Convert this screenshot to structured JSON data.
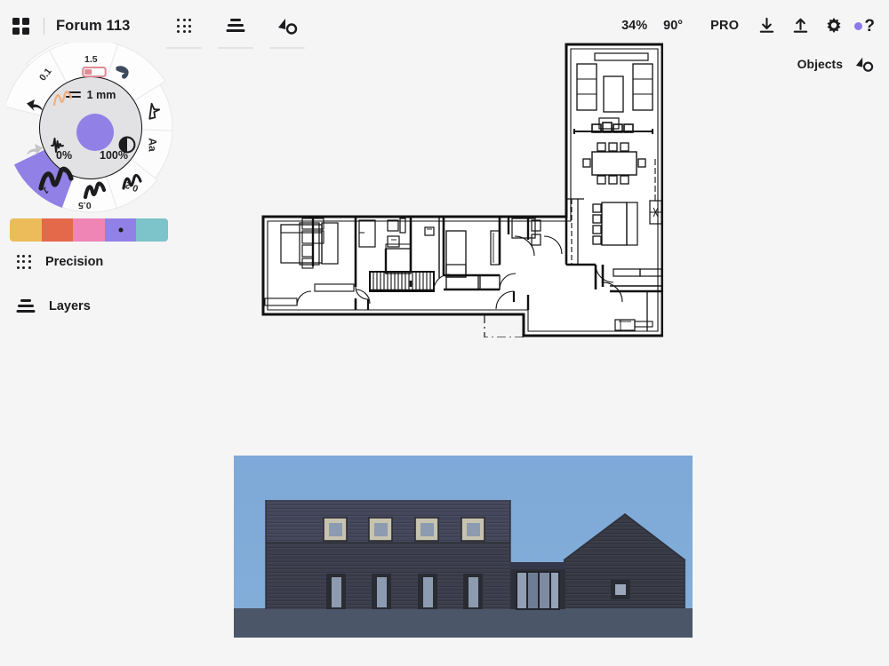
{
  "app": {
    "background": "#f5f5f6",
    "accent": "#9180e6"
  },
  "topbar": {
    "apps_icon": "grid-squares-icon",
    "document_title": "Forum 113",
    "tools": [
      {
        "name": "precision-grid-tool",
        "icon": "nine-dots-icon"
      },
      {
        "name": "layers-tool",
        "icon": "layer-stack-icon"
      },
      {
        "name": "objects-tool",
        "icon": "object-node-icon"
      }
    ],
    "zoom_level": "34%",
    "rotation": "90°",
    "pro_label": "PRO",
    "download_icon": "download-icon",
    "upload_icon": "upload-icon",
    "settings_icon": "gear-icon",
    "help_icon": "help-question-icon"
  },
  "objects_bar": {
    "label": "Objects",
    "icon": "object-node-icon"
  },
  "wheel": {
    "hub": {
      "line_icon": "line-weight-icon",
      "size_value": "1 mm",
      "opacity_min": "0%",
      "opacity_max": "100%",
      "pressure_icon": "pressure-curve-icon",
      "contrast_icon": "contrast-half-circle-icon",
      "color_swatch": "#9180e6"
    },
    "segments": [
      {
        "name": "wheel-segment-0-1",
        "label": "0.1",
        "glyph": "stroke-thin-icon",
        "selected": false,
        "color": "#f0b183"
      },
      {
        "name": "wheel-segment-1-5",
        "label": "1.5",
        "glyph": "eraser-icon",
        "selected": false,
        "color": "#de8b95"
      },
      {
        "name": "wheel-segment-marker",
        "label": "",
        "glyph": "marker-blob-icon",
        "selected": false,
        "color": "#3d4a5c"
      },
      {
        "name": "wheel-segment-select",
        "label": "",
        "glyph": "cursor-arrow-icon",
        "selected": false,
        "color": "#1c1c1e"
      },
      {
        "name": "wheel-segment-text",
        "label": "Aa",
        "glyph": "text-icon",
        "selected": false,
        "color": "#1c1c1e"
      },
      {
        "name": "wheel-segment-0-2",
        "label": "0.2",
        "glyph": "stroke-medium-icon",
        "selected": false,
        "color": "#1c1c1e"
      },
      {
        "name": "wheel-segment-0-5",
        "label": "0.5",
        "glyph": "stroke-thick-icon",
        "selected": false,
        "color": "#1c1c1e"
      },
      {
        "name": "wheel-segment-1",
        "label": "1",
        "glyph": "stroke-current-icon",
        "selected": true,
        "color": "#9180e6"
      }
    ],
    "undo_icon": "undo-arrow-icon",
    "redo_icon": "redo-arrow-icon",
    "redo_disabled": true
  },
  "palette": {
    "swatches": [
      {
        "name": "color-swatch-yellow",
        "color": "#edbc5a",
        "selected": false
      },
      {
        "name": "color-swatch-orange",
        "color": "#e4684a",
        "selected": false
      },
      {
        "name": "color-swatch-pink",
        "color": "#ee85b5",
        "selected": false
      },
      {
        "name": "color-swatch-purple",
        "color": "#9180e6",
        "selected": true
      },
      {
        "name": "color-swatch-teal",
        "color": "#7cc4c9",
        "selected": false
      }
    ]
  },
  "sidebar": {
    "precision": {
      "label": "Precision",
      "icon": "nine-dots-icon"
    },
    "layers": {
      "label": "Layers",
      "icon": "layer-stack-icon"
    }
  },
  "canvas": {
    "floorplan": {
      "name": "architectural-floor-plan",
      "description": "L-shaped building floor plan with furnished rooms, stairs and meeting room wing"
    },
    "elevation": {
      "name": "architectural-elevation-render",
      "description": "Dark timber-clad two-storey building elevation against blue sky",
      "sky_color": "#7ba7d7",
      "ground_color": "#4b5668",
      "facade_color": "#3a3c4a",
      "gable_color": "#3b3d4b",
      "glass_color": "#8d9bb0",
      "frame_color": "#c8c3ae"
    }
  }
}
